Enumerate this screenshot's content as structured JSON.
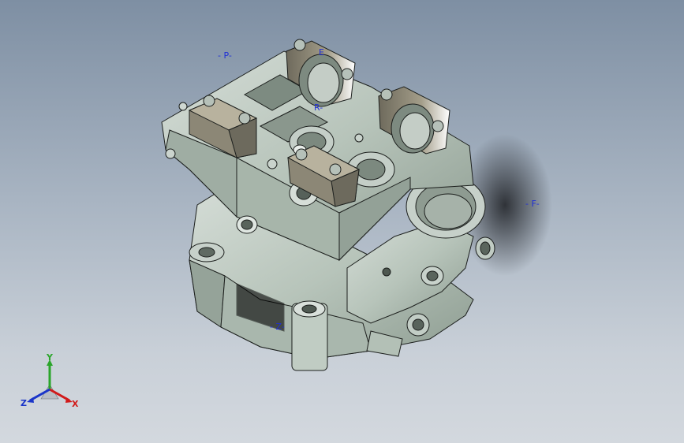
{
  "viewport": {
    "colors": {
      "background_top": "#7e8fa3",
      "background_bottom": "#d3d8de",
      "part_fill": "#b9c6bd",
      "part_edge": "#1c1f1d",
      "annotation": "#1f2fd6"
    }
  },
  "annotations": {
    "p": "- P-",
    "e": "E",
    "r": "R-",
    "f": "- F-",
    "z": "- Z-"
  },
  "model": {
    "icon": "engine-cylinder-head-model"
  },
  "triad": {
    "y_label": "Y",
    "z_label": "Z",
    "x_label": "X",
    "colors": {
      "x": "#d11a1a",
      "y": "#2aa52a",
      "z": "#1a35c9"
    }
  }
}
